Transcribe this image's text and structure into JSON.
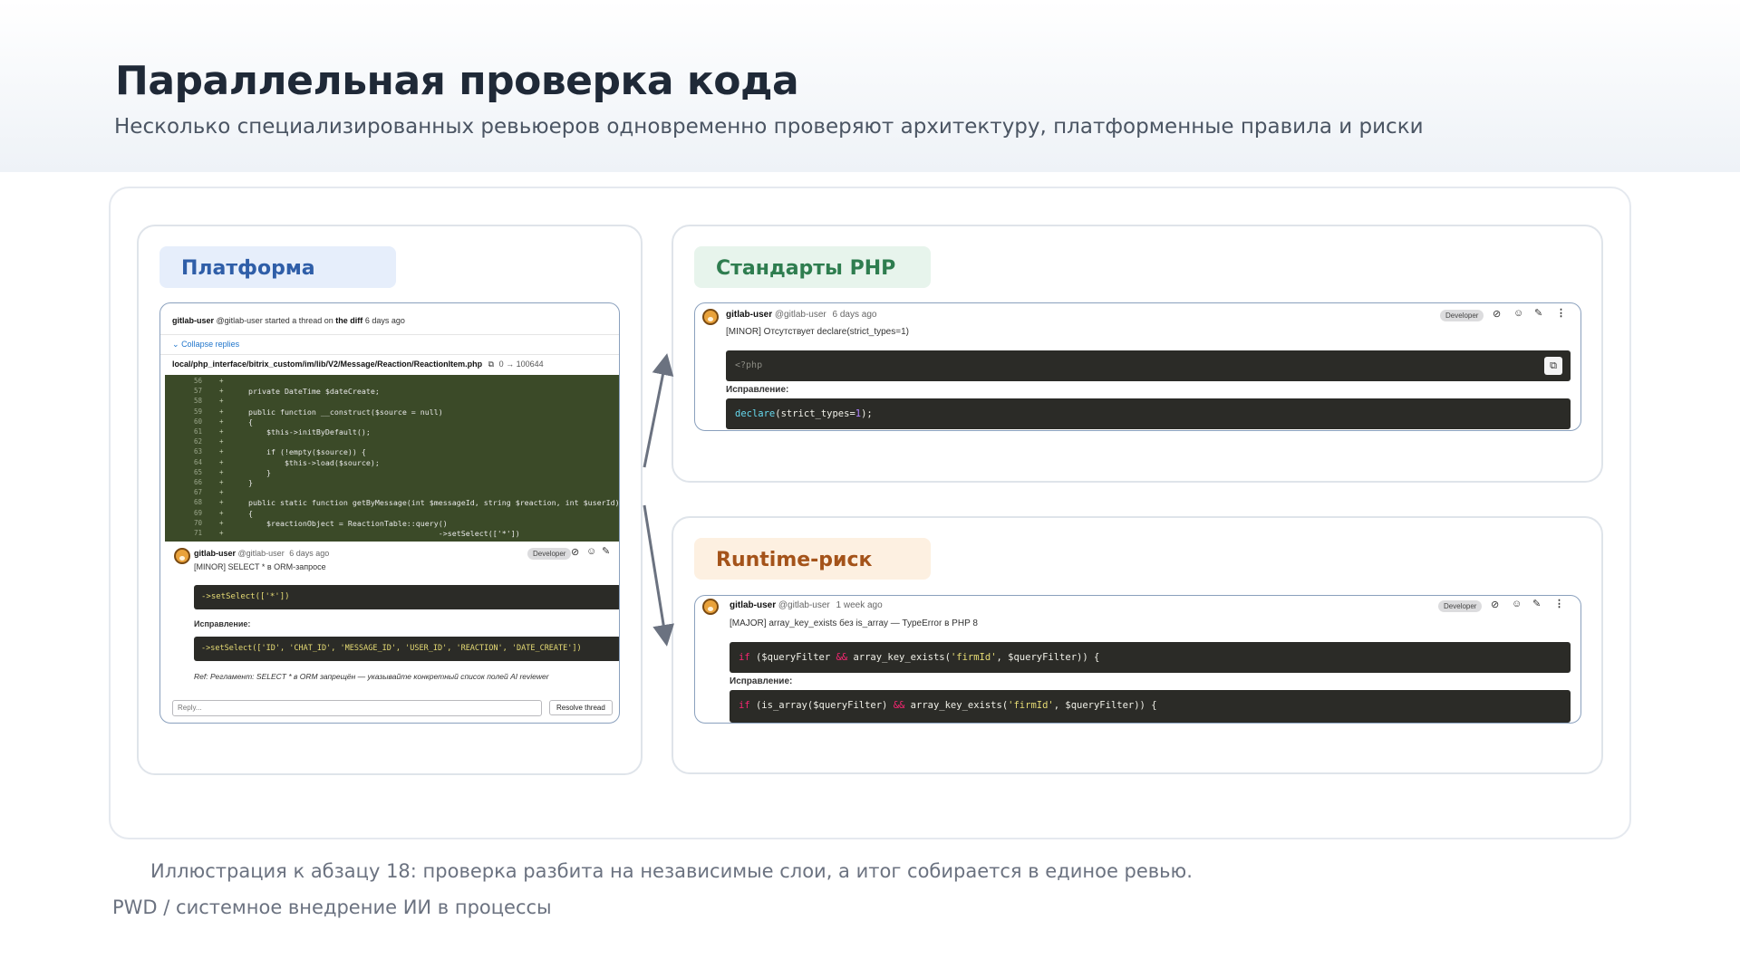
{
  "header": {
    "title": "Параллельная проверка кода",
    "subtitle": "Несколько специализированных ревьюеров одновременно проверяют архитектуру, платформенные правила и риски"
  },
  "panels": {
    "platform": {
      "label": "Платформа",
      "thread": {
        "user": "gitlab-user",
        "handle": "@gitlab-user",
        "action": "started a thread on",
        "target": "the diff",
        "time": "6 days ago",
        "collapse": "Collapse replies",
        "file": "local/php_interface/bitrix_custom/im/lib/V2/Message/Reaction/ReactionItem.php",
        "file_mode": "0 → 100644",
        "code_lines": [
          {
            "n": "56",
            "text": ""
          },
          {
            "n": "57",
            "text": "    private DateTime $dateCreate;"
          },
          {
            "n": "58",
            "text": ""
          },
          {
            "n": "59",
            "text": "    public function __construct($source = null)"
          },
          {
            "n": "60",
            "text": "    {"
          },
          {
            "n": "61",
            "text": "        $this->initByDefault();"
          },
          {
            "n": "62",
            "text": ""
          },
          {
            "n": "63",
            "text": "        if (!empty($source)) {"
          },
          {
            "n": "64",
            "text": "            $this->load($source);"
          },
          {
            "n": "65",
            "text": "        }"
          },
          {
            "n": "66",
            "text": "    }"
          },
          {
            "n": "67",
            "text": ""
          },
          {
            "n": "68",
            "text": "    public static function getByMessage(int $messageId, string $reaction, int $userId): ?self"
          },
          {
            "n": "69",
            "text": "    {"
          },
          {
            "n": "70",
            "text": "        $reactionObject = ReactionTable::query()"
          },
          {
            "n": "71",
            "text": "                                              ->setSelect(['*'])"
          }
        ],
        "comment": {
          "user": "gitlab-user",
          "handle": "@gitlab-user",
          "time": "6 days ago",
          "role": "Developer",
          "title": "[MINOR] SELECT * в ORM-запросе",
          "code": "->setSelect(['*'])",
          "fix_label": "Исправление:",
          "fix_code": "->setSelect(['ID', 'CHAT_ID', 'MESSAGE_ID', 'USER_ID', 'REACTION', 'DATE_CREATE'])",
          "ref": "Ref: Регламент: SELECT * в ORM запрещён — указывайте конкретный список полей AI reviewer"
        },
        "reply_placeholder": "Reply...",
        "resolve_label": "Resolve thread"
      }
    },
    "php": {
      "label": "Стандарты PHP",
      "comment": {
        "user": "gitlab-user",
        "handle": "@gitlab-user",
        "time": "6 days ago",
        "role": "Developer",
        "title": "[MINOR] Отсутствует declare(strict_types=1)",
        "code": "<?php",
        "fix_label": "Исправление:",
        "fix_code": "declare(strict_types=1);"
      }
    },
    "runtime": {
      "label": "Runtime-риск",
      "comment": {
        "user": "gitlab-user",
        "handle": "@gitlab-user",
        "time": "1 week ago",
        "role": "Developer",
        "title": "[MAJOR] array_key_exists без is_array — TypeError в PHP 8",
        "code": "if ($queryFilter && array_key_exists('firmId', $queryFilter)) {",
        "fix_label": "Исправление:",
        "fix_code": "if (is_array($queryFilter) && array_key_exists('firmId', $queryFilter)) {"
      }
    }
  },
  "caption": "Иллюстрация к абзацу 18: проверка разбита на независимые слои, а итог собирается в единое ревью.",
  "footer": "PWD / системное внедрение ИИ в процессы",
  "colors": {
    "platform_accent": "#2f5ea8",
    "php_accent": "#2e7d4f",
    "runtime_accent": "#a4531a",
    "code_bg": "#2b2b27",
    "diff_bg": "#3b4a28"
  }
}
